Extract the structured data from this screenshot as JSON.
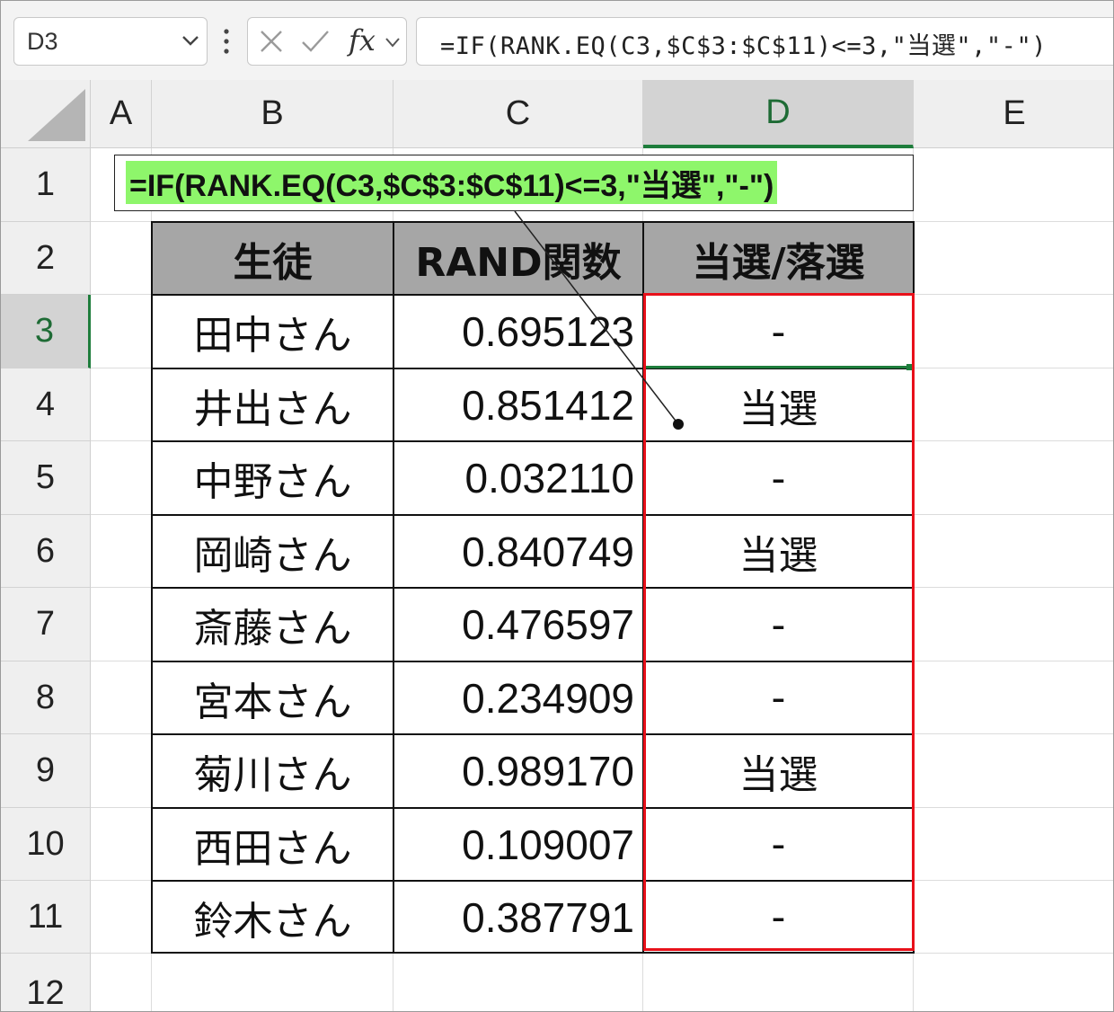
{
  "formula_bar": {
    "name_box": "D3",
    "fx_label": "fx",
    "formula": "=IF(RANK.EQ(C3,$C$3:$C$11)<=3,\"当選\",\"-\")"
  },
  "columns": [
    "A",
    "B",
    "C",
    "D",
    "E"
  ],
  "rows": [
    "1",
    "2",
    "3",
    "4",
    "5",
    "6",
    "7",
    "8",
    "9",
    "10",
    "11",
    "12"
  ],
  "callout": {
    "text": "=IF(RANK.EQ(C3,$C$3:$C$11)<=3,\"当選\",\"-\")"
  },
  "table": {
    "headers": [
      "生徒",
      "RAND関数",
      "当選/落選"
    ],
    "rows": [
      {
        "name": "田中さん",
        "value": "0.695123",
        "result": "-"
      },
      {
        "name": "井出さん",
        "value": "0.851412",
        "result": "当選"
      },
      {
        "name": "中野さん",
        "value": "0.032110",
        "result": "-"
      },
      {
        "name": "岡崎さん",
        "value": "0.840749",
        "result": "当選"
      },
      {
        "name": "斎藤さん",
        "value": "0.476597",
        "result": "-"
      },
      {
        "name": "宮本さん",
        "value": "0.234909",
        "result": "-"
      },
      {
        "name": "菊川さん",
        "value": "0.989170",
        "result": "当選"
      },
      {
        "name": "西田さん",
        "value": "0.109007",
        "result": "-"
      },
      {
        "name": "鈴木さん",
        "value": "0.387791",
        "result": "-"
      }
    ]
  },
  "colors": {
    "accent_green": "#1e7d3c",
    "highlight": "#8ef66b",
    "red_box": "#e8101a",
    "header_fill": "#a6a6a6"
  }
}
